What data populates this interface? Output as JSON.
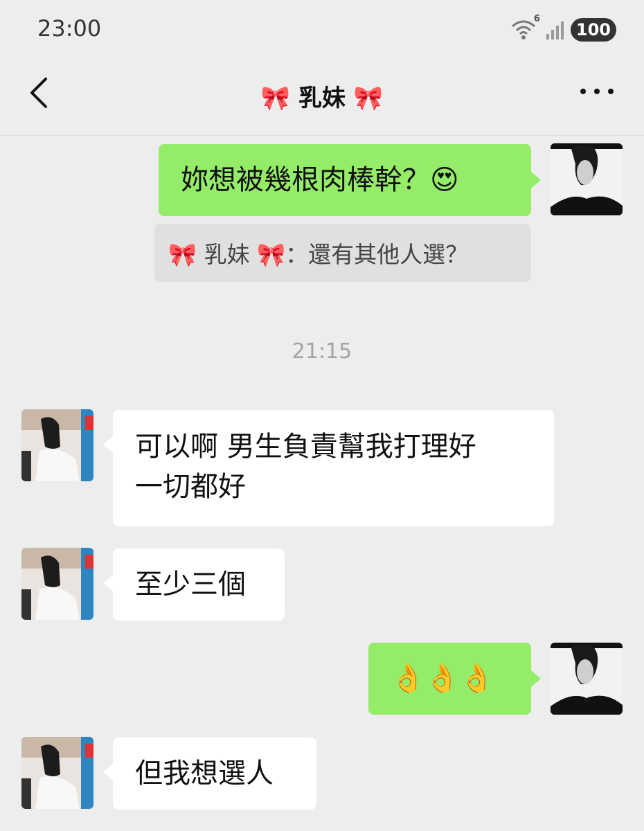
{
  "status_bar": {
    "time": "23:00",
    "wifi_label": "6",
    "battery": "100"
  },
  "nav": {
    "title": "🎀 乳妹 🎀"
  },
  "messages": [
    {
      "side": "right",
      "text": "妳想被幾根肉棒幹？😍"
    },
    {
      "side": "right-quote",
      "text": "🎀 乳妹 🎀：還有其他人選？"
    },
    {
      "side": "left",
      "text_line1": "可以啊 男生負責幫我打理好",
      "text_line2": "一切都好"
    },
    {
      "side": "left",
      "text": "至少三個"
    },
    {
      "side": "right",
      "text": "👌👌👌"
    },
    {
      "side": "left",
      "text": "但我想選人"
    }
  ],
  "timestamp": "21:15",
  "colors": {
    "background": "#ededed",
    "sent_bubble": "#95ec69",
    "received_bubble": "#ffffff",
    "quote_box": "#e0e0e0"
  },
  "icons": {
    "back": "chevron-left-icon",
    "more": "more-dots-icon",
    "wifi": "wifi-icon",
    "signal": "signal-bars-icon"
  }
}
